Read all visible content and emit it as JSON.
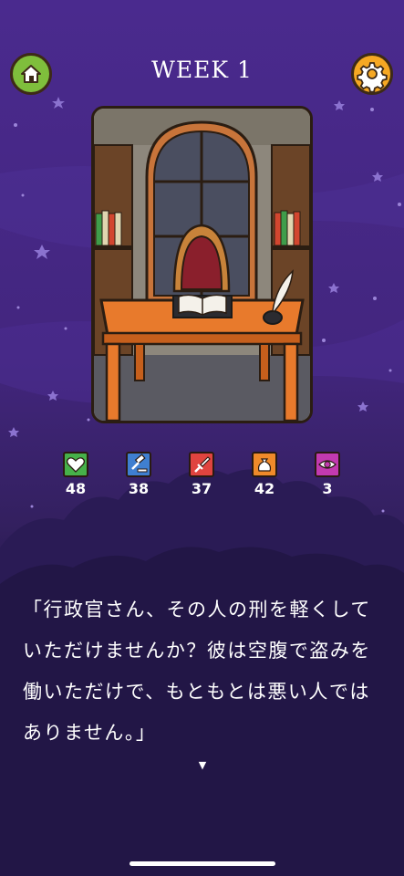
{
  "header": {
    "title": "WEEK 1",
    "home_icon": "home-icon",
    "settings_icon": "gear-icon"
  },
  "scene": {
    "illustration": "office-desk-scene"
  },
  "stats": [
    {
      "name": "heart-stat",
      "icon": "heart-icon",
      "value": "48",
      "color": "#46b04a"
    },
    {
      "name": "justice-stat",
      "icon": "gavel-icon",
      "value": "38",
      "color": "#3f7fd0"
    },
    {
      "name": "military-stat",
      "icon": "sword-icon",
      "value": "37",
      "color": "#e0443f"
    },
    {
      "name": "wealth-stat",
      "icon": "money-bag-icon",
      "value": "42",
      "color": "#f08a2a"
    },
    {
      "name": "insight-stat",
      "icon": "eye-icon",
      "value": "3",
      "color": "#c23ab0"
    }
  ],
  "dialogue": {
    "line1": "「行政官さん、その人の刑を軽くして",
    "line2": "いただけませんか？彼は空腹で盗みを",
    "line3": "働いただけで、もともとは悪い人では",
    "line4": "ありません。」",
    "continue_icon": "continue-triangle-icon"
  },
  "colors": {
    "background_top": "#4a2a8e",
    "background_bottom": "#17103a",
    "home_button": "#7fbe3c",
    "settings_button": "#f6a823"
  }
}
